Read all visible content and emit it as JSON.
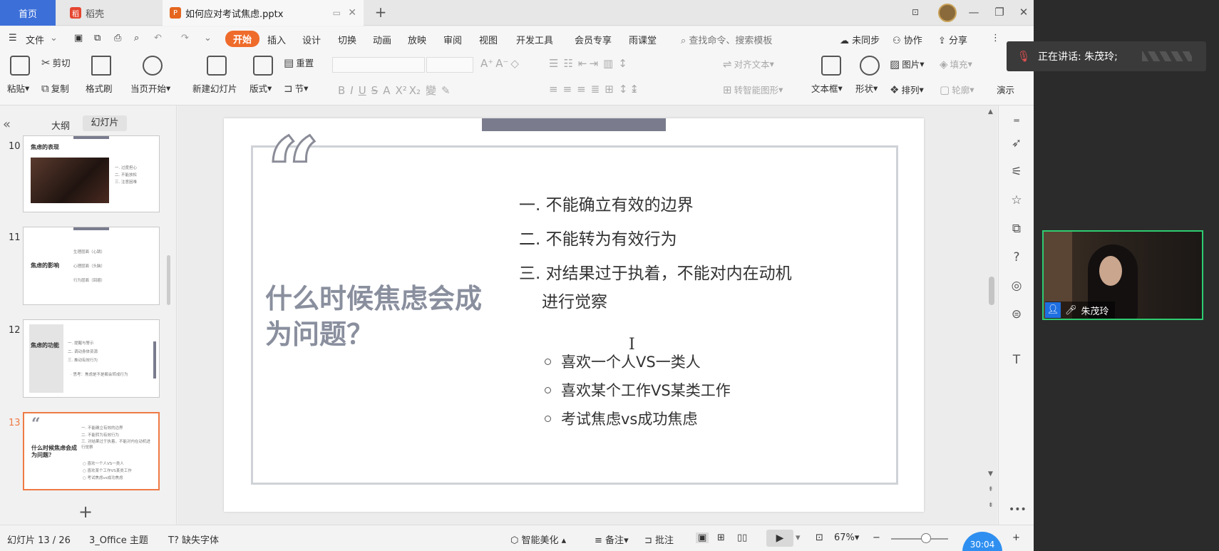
{
  "titlebar": {
    "tabs": [
      {
        "label": "首页",
        "icon": ""
      },
      {
        "label": "稻壳",
        "icon": "daoke-icon"
      },
      {
        "label": "如何应对考试焦虑.pptx",
        "icon": "ppt-icon"
      }
    ],
    "new_tab": "+",
    "window_controls": [
      "—",
      "❐",
      "✕"
    ]
  },
  "menubar": {
    "file": "文件",
    "items": [
      "开始",
      "插入",
      "设计",
      "切换",
      "动画",
      "放映",
      "审阅",
      "视图",
      "开发工具",
      "会员专享",
      "雨课堂"
    ],
    "search": "查找命令、搜索模板",
    "sync": "未同步",
    "collab": "协作",
    "share": "分享"
  },
  "ribbon": {
    "paste": "粘贴",
    "cut": "剪切",
    "copy": "复制",
    "format_painter": "格式刷",
    "play_from_current": "当页开始",
    "new_slide": "新建幻灯片",
    "layout": "版式",
    "reset": "重置",
    "section": "节",
    "align_text": "对齐文本",
    "smart_shape": "转智能图形",
    "textbox": "文本框",
    "shape": "形状",
    "picture": "图片",
    "arrange": "排列",
    "fill": "填充",
    "outline": "轮廓",
    "present": "演示"
  },
  "leftpane": {
    "tab_outline": "大纲",
    "tab_slides": "幻灯片",
    "slides": [
      {
        "no": "10",
        "title": "焦虑的表现",
        "lines": [
          "一. 过度担心",
          "二. 不能放松",
          "三. 注意困难"
        ]
      },
      {
        "no": "11",
        "title": "焦虑的影响",
        "lines": [
          "生理层面（心跳）",
          "心理层面（头脑）",
          "行为层面（回避）"
        ]
      },
      {
        "no": "12",
        "title": "焦虑的功能",
        "lines": [
          "一. 提醒与警示",
          "二. 调动身体资源",
          "三. 推动有效行为",
          "· 思考：焦虑是不是都会转成行为"
        ]
      },
      {
        "no": "13",
        "title": "什么时候焦虑会成为问题？",
        "lines": [
          "一. 不能确立有效的边界",
          "二. 不能转为有效行为",
          "三. 对结果过于执着，不能对内在动机进行觉察",
          "○ 喜欢一个人VS一类人",
          "○ 喜欢某个工作VS某类工作",
          "○ 考试焦虑vs成功焦虑"
        ]
      }
    ]
  },
  "slide": {
    "heading": "什么时候焦虑会成为问题？",
    "points": [
      "一. 不能确立有效的边界",
      "二. 不能转为有效行为",
      "三. 对结果过于执着，不能对内在动机",
      "进行觉察"
    ],
    "subpoints": [
      "喜欢一个人VS一类人",
      "喜欢某个工作VS某类工作",
      "考试焦虑vs成功焦虑"
    ],
    "quote": "“"
  },
  "statusbar": {
    "slide_counter": "幻灯片 13 / 26",
    "theme": "3_Office 主题",
    "missing_font": "缺失字体",
    "beautify": "智能美化",
    "notes": "备注",
    "comments": "批注",
    "zoom": "67%",
    "timer": "30:04"
  },
  "meeting": {
    "speaking": "正在讲话: 朱茂玲;",
    "participant": "朱茂玲"
  }
}
